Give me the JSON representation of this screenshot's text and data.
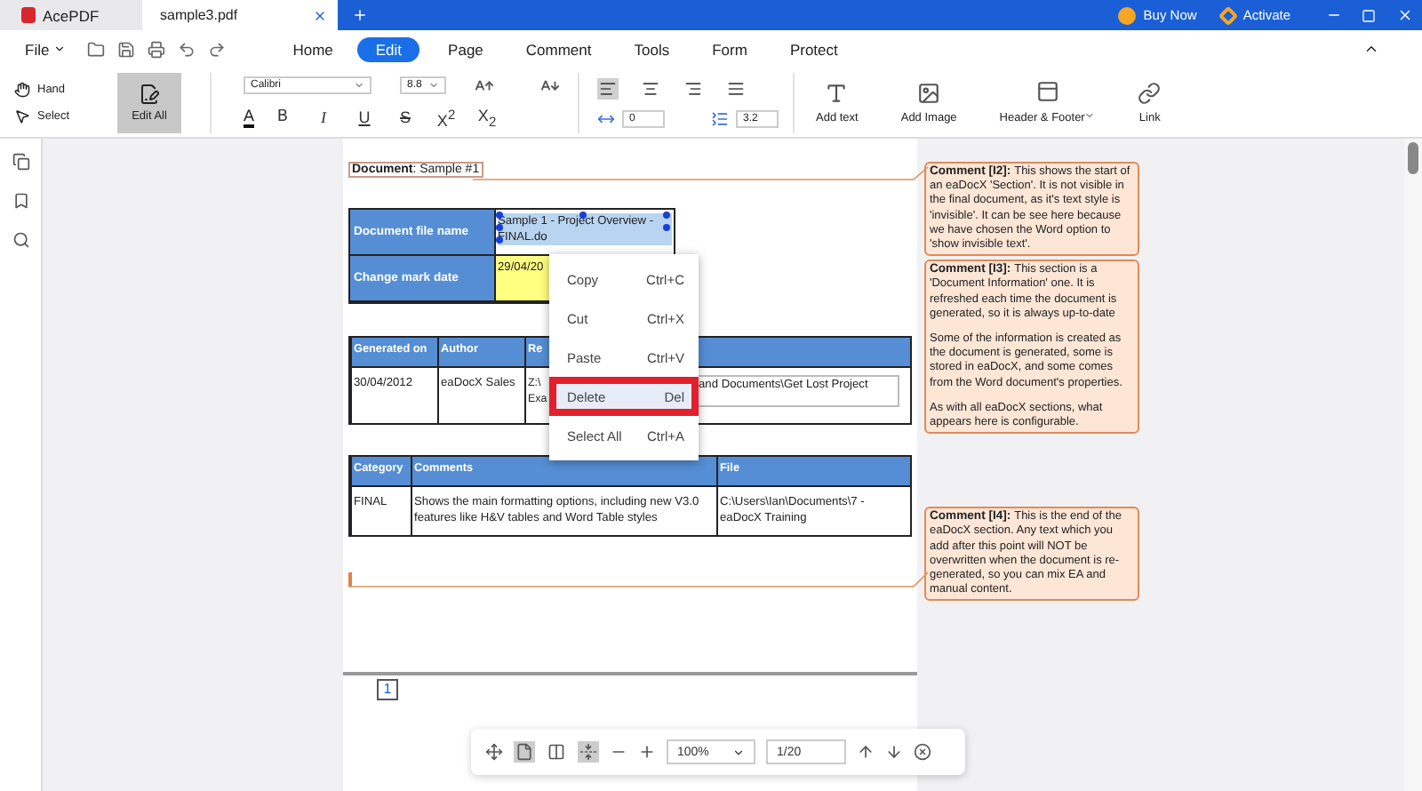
{
  "app": {
    "name": "AcePDF"
  },
  "tabs": [
    {
      "label": "sample3.pdf",
      "selected": true
    }
  ],
  "title_actions": [
    {
      "label": "Buy Now",
      "kind": "buy"
    },
    {
      "label": "Activate",
      "kind": "activate"
    }
  ],
  "menu": {
    "file": "File",
    "ribbon_tabs": [
      {
        "label": "Home",
        "selected": false
      },
      {
        "label": "Edit",
        "selected": true
      },
      {
        "label": "Page",
        "selected": false
      },
      {
        "label": "Comment",
        "selected": false
      },
      {
        "label": "Tools",
        "selected": false
      },
      {
        "label": "Form",
        "selected": false
      },
      {
        "label": "Protect",
        "selected": false
      }
    ]
  },
  "toolbar": {
    "modes": [
      {
        "label": "Hand",
        "kind": "hand"
      },
      {
        "label": "Select",
        "kind": "select"
      }
    ],
    "edit_all": {
      "label": "Edit All",
      "selected": true
    },
    "font": "Calibri",
    "size": "8.8",
    "format": [
      {
        "label": "B",
        "kind": "bold"
      },
      {
        "label": "I",
        "kind": "italic"
      },
      {
        "label": "U",
        "kind": "underline"
      },
      {
        "label": "S",
        "kind": "strike"
      },
      {
        "label": "X$^{2}$",
        "kind": "sup"
      },
      {
        "label": "X$_{2}$",
        "kind": "sub"
      }
    ],
    "color_label": "A",
    "align": [
      {
        "kind": "left",
        "selected": true
      },
      {
        "kind": "center",
        "selected": false
      },
      {
        "kind": "right",
        "selected": false
      },
      {
        "kind": "justify",
        "selected": false
      }
    ],
    "char_spacing": "0",
    "line_spacing": "3.2",
    "tools": [
      {
        "label": "Add text",
        "kind": "text"
      },
      {
        "label": "Add Image",
        "kind": "image"
      },
      {
        "label": "Header & Footer",
        "kind": "header"
      },
      {
        "label": "Link",
        "kind": "link"
      }
    ]
  },
  "document": {
    "label": "**Document**: Sample #1",
    "info_table": [
      {
        "header": "Document file name",
        "value": "Sample 1 - Project Overview - FINAL.do",
        "selected": true,
        "highlighted": false
      },
      {
        "header": "Change mark date",
        "value": "29/04/20",
        "selected": false,
        "highlighted": true
      }
    ],
    "tables": [
      {
        "columns": [
          "Generated on",
          "Author",
          "Re"
        ],
        "rows": [
          [
            "30/04/2012",
            "eaDocX Sales",
            {
              "parts": [
                "Z:\\ Exa",
                "and Documents\\Get Lost Project"
              ]
            }
          ]
        ]
      },
      {
        "columns": [
          "Category",
          "Comments",
          "File"
        ],
        "rows": [
          [
            "FINAL",
            "Shows the main formatting options, including new V3.0 features like H&V tables and Word Table styles",
            "C:\\Users\\Ian\\Documents\\7 - eaDocX Training"
          ]
        ]
      }
    ],
    "page_number": "1"
  },
  "context_menu": [
    {
      "label": "Copy",
      "shortcut": "Ctrl+C",
      "selected": false
    },
    {
      "label": "Cut",
      "shortcut": "Ctrl+X",
      "selected": false
    },
    {
      "label": "Paste",
      "shortcut": "Ctrl+V",
      "selected": false
    },
    {
      "label": "Delete",
      "shortcut": "Del",
      "selected": true
    },
    {
      "label": "Select All",
      "shortcut": "Ctrl+A",
      "selected": false
    }
  ],
  "comments": [
    {
      "title": "Comment [I2]:",
      "paragraphs": [
        "This shows the start of an eaDocX 'Section'. It is not visible in the final document, as it's text style is 'invisible'. It can be see here because we have chosen the Word option to 'show invisible text'."
      ]
    },
    {
      "title": "Comment [I3]:",
      "paragraphs": [
        "This section is a 'Document Information' one. It is refreshed each time the document is generated, so it is always up-to-date",
        "Some of the information is created as the document is generated, some is stored in eaDocX, and some comes from the Word document's properties.",
        "As with all eaDocX sections, what appears here is configurable."
      ]
    },
    {
      "title": "Comment [I4]:",
      "paragraphs": [
        "This is the end of the eaDocX section. Any text which you add after this point will NOT be overwritten when the document is re-generated, so you can mix EA and manual content."
      ]
    }
  ],
  "zoom_bar": {
    "view_modes": [
      {
        "kind": "single",
        "selected": true
      },
      {
        "kind": "double",
        "selected": false
      },
      {
        "kind": "continuous",
        "selected": true
      }
    ],
    "zoom": "100%",
    "page": "1/20"
  }
}
